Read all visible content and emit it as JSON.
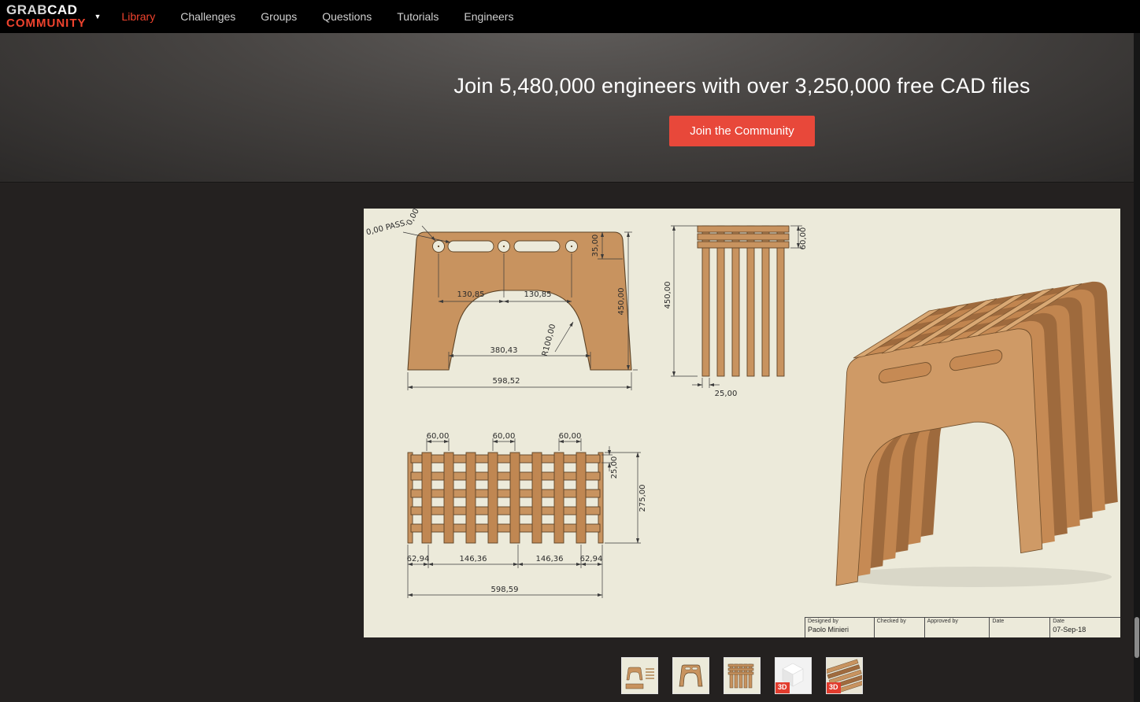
{
  "colors": {
    "brand_red": "#f0432e",
    "cta_red": "#e8483a",
    "badge_red": "#e23c2e",
    "sheet_background": "#eceada",
    "wood": "#c8935f"
  },
  "navbar": {
    "logo_line1_a": "GRAB",
    "logo_line1_b": "CAD",
    "logo_line2": "COMMUNITY",
    "items": [
      {
        "label": "Library"
      },
      {
        "label": "Challenges"
      },
      {
        "label": "Groups"
      },
      {
        "label": "Questions"
      },
      {
        "label": "Tutorials"
      },
      {
        "label": "Engineers"
      }
    ]
  },
  "hero": {
    "headline": "Join 5,480,000 engineers with over 3,250,000 free CAD files",
    "cta_label": "Join the Community"
  },
  "drawing": {
    "front_view": {
      "callout_rot": "0,00",
      "callout_pass": "0,00 PASS.",
      "dim_band": "35,00",
      "dim_left": "130,85",
      "dim_right": "130,85",
      "dim_radius": "R100,00",
      "dim_inner": "380,43",
      "dim_width": "598,52",
      "dim_height": "450,00"
    },
    "side_view": {
      "dim_band": "60,00",
      "dim_height": "450,00",
      "dim_thickness": "25,00"
    },
    "top_view": {
      "dim_gap1": "60,00",
      "dim_gap2": "60,00",
      "dim_gap3": "60,00",
      "dim_slat": "25,00",
      "dim_depth": "275,00",
      "dim_e1": "62,94",
      "dim_m1": "146,36",
      "dim_m2": "146,36",
      "dim_e2": "62,94",
      "dim_width": "598,59"
    },
    "title_block": {
      "designed_label": "Designed by",
      "designed_value": "Paolo Minieri",
      "checked_label": "Checked by",
      "approved_label": "Approved by",
      "date_label": "Date",
      "date2_label": "Date",
      "date_value": "07-Sep-18"
    }
  },
  "thumbnails": {
    "badge": "3D"
  }
}
